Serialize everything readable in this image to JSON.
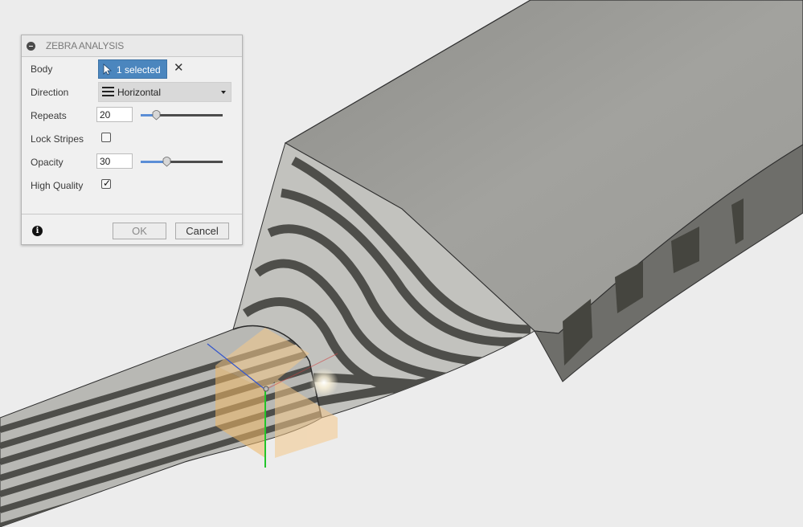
{
  "dialog": {
    "title": "ZEBRA ANALYSIS",
    "body_label": "Body",
    "body_selection": "1 selected",
    "clear_icon": "✕",
    "direction_label": "Direction",
    "direction_value": "Horizontal",
    "repeats_label": "Repeats",
    "repeats_value": "20",
    "repeats_slider_fraction": 0.19,
    "lock_stripes_label": "Lock Stripes",
    "lock_stripes_checked": false,
    "opacity_label": "Opacity",
    "opacity_value": "30",
    "opacity_slider_fraction": 0.31,
    "high_quality_label": "High Quality",
    "high_quality_checked": true,
    "info_icon": "i",
    "ok_label": "OK",
    "cancel_label": "Cancel"
  },
  "viewport": {
    "background_color": "#ececec",
    "model_color": "#9c9c98",
    "stripe_dark": "#4e4e4a",
    "stripe_light": "#c2c2be",
    "gizmo_color": "#f5c98a",
    "axis_y_color": "#22c42a",
    "axis_x_color": "#3355cc"
  }
}
